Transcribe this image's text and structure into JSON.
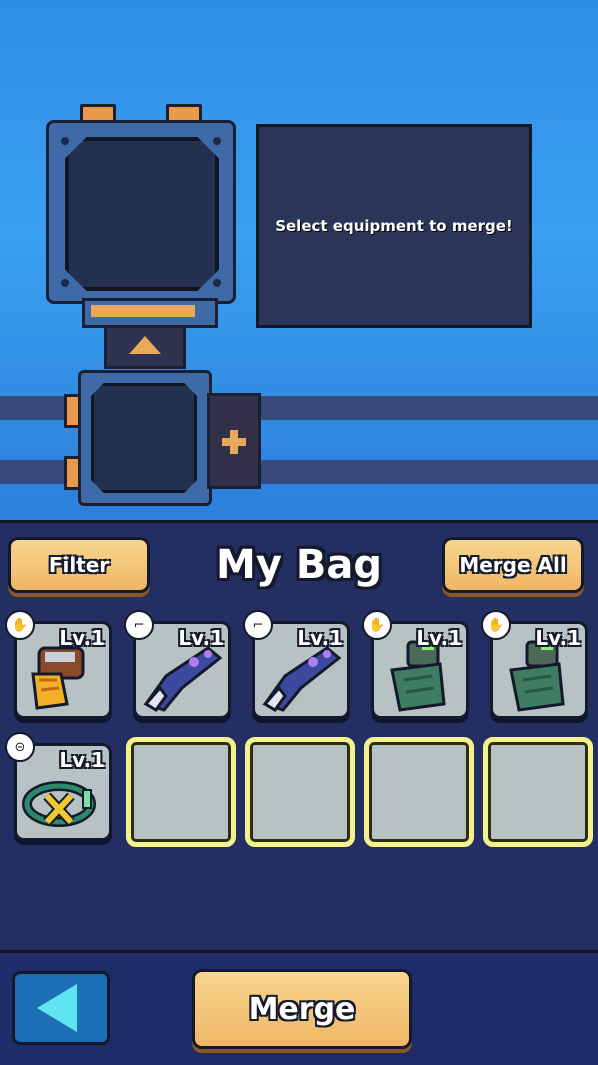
{
  "merge_panel": {
    "info_text": "Select equipment to merge!"
  },
  "bag": {
    "title": "My Bag",
    "filter_label": "Filter",
    "merge_all_label": "Merge All",
    "items": [
      {
        "level": "Lv.1",
        "type": "glove",
        "icon": "orange-gauntlet-icon"
      },
      {
        "level": "Lv.1",
        "type": "gun",
        "icon": "blue-blaster-icon"
      },
      {
        "level": "Lv.1",
        "type": "gun",
        "icon": "blue-blaster-icon"
      },
      {
        "level": "Lv.1",
        "type": "glove",
        "icon": "green-glove-icon"
      },
      {
        "level": "Lv.1",
        "type": "glove",
        "icon": "green-glove-icon"
      },
      {
        "level": "Lv.1",
        "type": "belt",
        "icon": "x-belt-icon"
      }
    ],
    "empty_slots": 4
  },
  "footer": {
    "merge_label": "Merge",
    "back_icon": "back-arrow-icon"
  },
  "colors": {
    "button_orange": "#eeb765",
    "empty_slot_border": "#f3f28c",
    "panel_bg": "#232f63"
  }
}
